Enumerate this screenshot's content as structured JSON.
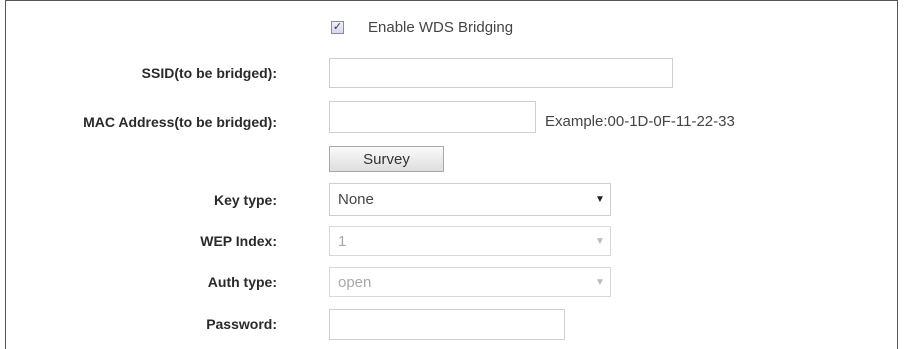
{
  "wds": {
    "enable_label": "Enable WDS Bridging",
    "enabled": true,
    "checkbox_glyph": "✓"
  },
  "ssid": {
    "label": "SSID(to be bridged):",
    "value": ""
  },
  "mac": {
    "label": "MAC Address(to be bridged):",
    "value": "",
    "example": "Example:00-1D-0F-11-22-33"
  },
  "survey_button": "Survey",
  "key_type": {
    "label": "Key type:",
    "value": "None"
  },
  "wep_index": {
    "label": "WEP Index:",
    "value": "1"
  },
  "auth_type": {
    "label": "Auth type:",
    "value": "open"
  },
  "password": {
    "label": "Password:",
    "value": ""
  },
  "icons": {
    "dropdown": "chevron-down-icon"
  }
}
